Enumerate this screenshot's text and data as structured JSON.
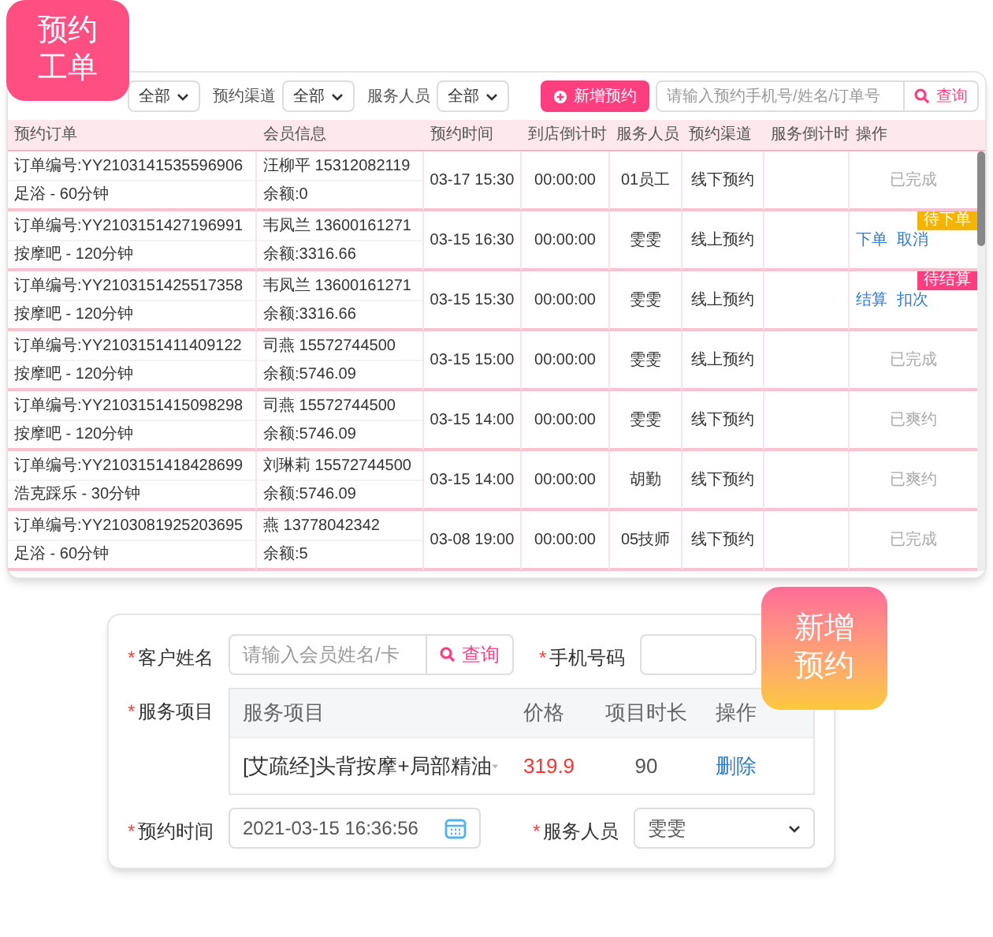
{
  "top_badge": {
    "lines": [
      "预约",
      "工单"
    ]
  },
  "filters": [
    {
      "value": "全部"
    },
    {
      "label": "预约渠道",
      "value": "全部"
    },
    {
      "label": "服务人员",
      "value": "全部"
    }
  ],
  "new_button": "新增预约",
  "search": {
    "placeholder": "请输入预约手机号/姓名/订单号",
    "button": "查询"
  },
  "table": {
    "columns": [
      "预约订单",
      "会员信息",
      "预约时间",
      "到店倒计时",
      "服务人员",
      "预约渠道",
      "服务倒计时",
      "操作"
    ],
    "rows": [
      {
        "order_no": "订单编号:YY2103141535596906",
        "service": "足浴 - 60分钟",
        "member": "汪柳平 15312082119",
        "balance": "余额:0",
        "time": "03-17 15:30",
        "countdown": "00:00:00",
        "staff": "01员工",
        "channel": "线下预约",
        "status": "已完成"
      },
      {
        "order_no": "订单编号:YY2103151427196991",
        "service": "按摩吧 - 120分钟",
        "member": "韦凤兰 13600161271",
        "balance": "余额:3316.66",
        "time": "03-15 16:30",
        "countdown": "00:00:00",
        "staff": "雯雯",
        "channel": "线上预约",
        "actions": [
          "下单",
          "取消"
        ],
        "tag": {
          "text": "待下单",
          "color": "#f5b400"
        }
      },
      {
        "order_no": "订单编号:YY2103151425517358",
        "service": "按摩吧 - 120分钟",
        "member": "韦凤兰 13600161271",
        "balance": "余额:3316.66",
        "time": "03-15 15:30",
        "countdown": "00:00:00",
        "staff": "雯雯",
        "channel": "线上预约",
        "actions": [
          "结算",
          "扣次"
        ],
        "tag": {
          "text": "待结算",
          "color": "#ff3d7f"
        }
      },
      {
        "order_no": "订单编号:YY2103151411409122",
        "service": "按摩吧 - 120分钟",
        "member": "司燕 15572744500",
        "balance": "余额:5746.09",
        "time": "03-15 15:00",
        "countdown": "00:00:00",
        "staff": "雯雯",
        "channel": "线上预约",
        "status": "已完成"
      },
      {
        "order_no": "订单编号:YY2103151415098298",
        "service": "按摩吧 - 120分钟",
        "member": "司燕 15572744500",
        "balance": "余额:5746.09",
        "time": "03-15 14:00",
        "countdown": "00:00:00",
        "staff": "雯雯",
        "channel": "线下预约",
        "status": "已爽约"
      },
      {
        "order_no": "订单编号:YY2103151418428699",
        "service": "浩克踩乐 - 30分钟",
        "member": "刘琳莉 15572744500",
        "balance": "余额:5746.09",
        "time": "03-15 14:00",
        "countdown": "00:00:00",
        "staff": "胡勤",
        "channel": "线下预约",
        "status": "已爽约"
      },
      {
        "order_no": "订单编号:YY2103081925203695",
        "service": "足浴 - 60分钟",
        "member": "燕 13778042342",
        "balance": "余额:5",
        "time": "03-08 19:00",
        "countdown": "00:00:00",
        "staff": "05技师",
        "channel": "线下预约",
        "status": "已完成"
      }
    ]
  },
  "bottom_badge": {
    "lines": [
      "新增",
      "预约"
    ]
  },
  "form": {
    "customer": {
      "mark": "*",
      "label": "客户姓名",
      "placeholder": "请输入会员姓名/卡",
      "button": "查询"
    },
    "phone": {
      "mark": "*",
      "label": "手机号码"
    },
    "service": {
      "mark": "*",
      "label": "服务项目",
      "columns": [
        "服务项目",
        "价格",
        "项目时长",
        "操作"
      ],
      "rows": [
        {
          "name": "[艾疏经]头背按摩+局部精油",
          "price": "319.9",
          "duration": "90",
          "action": "删除"
        }
      ]
    },
    "time": {
      "mark": "*",
      "label": "预约时间",
      "value": "2021-03-15 16:36:56"
    },
    "staff": {
      "mark": "*",
      "label": "服务人员",
      "value": "雯雯"
    }
  }
}
